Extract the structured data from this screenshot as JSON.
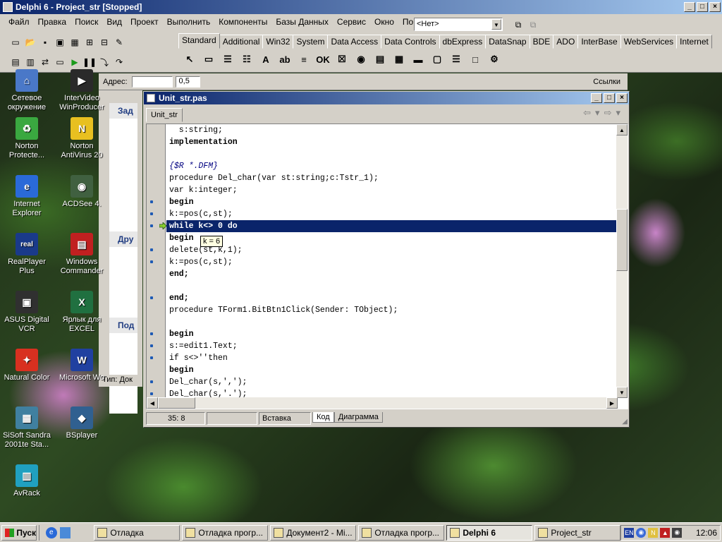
{
  "delphi": {
    "title": "Delphi 6 - Project_str [Stopped]",
    "menu": [
      "Файл",
      "Правка",
      "Поиск",
      "Вид",
      "Проект",
      "Выполнить",
      "Компоненты",
      "Базы Данных",
      "Сервис",
      "Окно",
      "Помощь"
    ],
    "config_combo": "<Нет>",
    "palette_tabs": [
      "Standard",
      "Additional",
      "Win32",
      "System",
      "Data Access",
      "Data Controls",
      "dbExpress",
      "DataSnap",
      "BDE",
      "ADO",
      "InterBase",
      "WebServices",
      "Internet"
    ],
    "active_palette_tab": "Standard"
  },
  "background_window": {
    "address_label": "Адрес:",
    "line_width": "0,5",
    "links_label": "Ссылки",
    "section_tasks": "Зад",
    "section_other": "Дру",
    "section_details": "Под",
    "status_type": "Тип: Док"
  },
  "unit_window": {
    "title": "Unit_str.pas",
    "tab": "Unit_str",
    "lines": [
      {
        "text": "  s:string;",
        "kw": false,
        "comment": false,
        "dot": false
      },
      {
        "text": "implementation",
        "kw": true,
        "comment": false,
        "dot": false
      },
      {
        "text": "",
        "kw": false,
        "comment": false,
        "dot": false
      },
      {
        "text": "{$R *.DFM}",
        "kw": false,
        "comment": true,
        "dot": false
      },
      {
        "text": "procedure Del_char(var st:string;c:Tstr_1);",
        "kw": false,
        "comment": false,
        "dot": false
      },
      {
        "text": "var k:integer;",
        "kw": false,
        "comment": false,
        "dot": false
      },
      {
        "text": "begin",
        "kw": true,
        "comment": false,
        "dot": true
      },
      {
        "text": "k:=pos(c,st);",
        "kw": false,
        "comment": false,
        "dot": true
      },
      {
        "text": "while k<> 0 do",
        "kw": true,
        "comment": false,
        "dot": true,
        "highlight": true
      },
      {
        "text": "begin",
        "kw": true,
        "comment": false,
        "dot": false
      },
      {
        "text": "delete(st,k,1);",
        "kw": false,
        "comment": false,
        "dot": true
      },
      {
        "text": "k:=pos(c,st);",
        "kw": false,
        "comment": false,
        "dot": true
      },
      {
        "text": "end;",
        "kw": true,
        "comment": false,
        "dot": false
      },
      {
        "text": "",
        "kw": false,
        "comment": false,
        "dot": false
      },
      {
        "text": "end;",
        "kw": true,
        "comment": false,
        "dot": true
      },
      {
        "text": "procedure TForm1.BitBtn1Click(Sender: TObject);",
        "kw": false,
        "comment": false,
        "dot": false
      },
      {
        "text": "",
        "kw": false,
        "comment": false,
        "dot": false
      },
      {
        "text": "begin",
        "kw": true,
        "comment": false,
        "dot": true
      },
      {
        "text": "s:=edit1.Text;",
        "kw": false,
        "comment": false,
        "dot": true
      },
      {
        "text": "if s<>''then",
        "kw": false,
        "comment": false,
        "dot": true
      },
      {
        "text": "begin",
        "kw": true,
        "comment": false,
        "dot": false
      },
      {
        "text": "Del_char(s,',');",
        "kw": false,
        "comment": false,
        "dot": true
      },
      {
        "text": "Del_char(s,'.');",
        "kw": false,
        "comment": false,
        "dot": true
      }
    ],
    "tooltip": "k = 6",
    "status_position": "35:  8",
    "status_mode": "Вставка",
    "view_tabs": [
      "Код",
      "Диаграмма"
    ],
    "active_view_tab": "Код"
  },
  "desktop_icons": [
    {
      "label": "Сетевое окружение",
      "color": "#4a78c8",
      "glyph": "⌂"
    },
    {
      "label": "InterVideo WinProducer",
      "color": "#2a2a2a",
      "glyph": "▶"
    },
    {
      "label": "Norton Protecte...",
      "color": "#3aa840",
      "glyph": "♻"
    },
    {
      "label": "Norton AntiVirus 20",
      "color": "#e8c020",
      "glyph": "N"
    },
    {
      "label": "Internet Explorer",
      "color": "#2a6ad8",
      "glyph": "e"
    },
    {
      "label": "ACDSee 4.",
      "color": "#406040",
      "glyph": "◉"
    },
    {
      "label": "RealPlayer Plus",
      "color": "#1a3a8a",
      "glyph": "real"
    },
    {
      "label": "Windows Commander",
      "color": "#c02020",
      "glyph": "▤"
    },
    {
      "label": "ASUS Digital VCR",
      "color": "#303030",
      "glyph": "▣"
    },
    {
      "label": "Ярлык для EXCEL",
      "color": "#207040",
      "glyph": "X"
    },
    {
      "label": "Natural Color",
      "color": "#d83020",
      "glyph": "✦"
    },
    {
      "label": "Microsoft Wo",
      "color": "#2040a0",
      "glyph": "W"
    },
    {
      "label": "SiSoft Sandra 2001te Sta...",
      "color": "#4080a0",
      "glyph": "▦"
    },
    {
      "label": "BSplayer",
      "color": "#306090",
      "glyph": "◆"
    },
    {
      "label": "AvRack",
      "color": "#20a0c0",
      "glyph": "▥"
    }
  ],
  "taskbar": {
    "start": "Пуск",
    "tasks": [
      "Отладка",
      "Отладка прогр...",
      "Документ2 - Mi...",
      "Отладка прогр...",
      "Delphi 6",
      "Project_str"
    ],
    "active_task": "Delphi 6",
    "clock": "12:06",
    "lang": "EN"
  }
}
